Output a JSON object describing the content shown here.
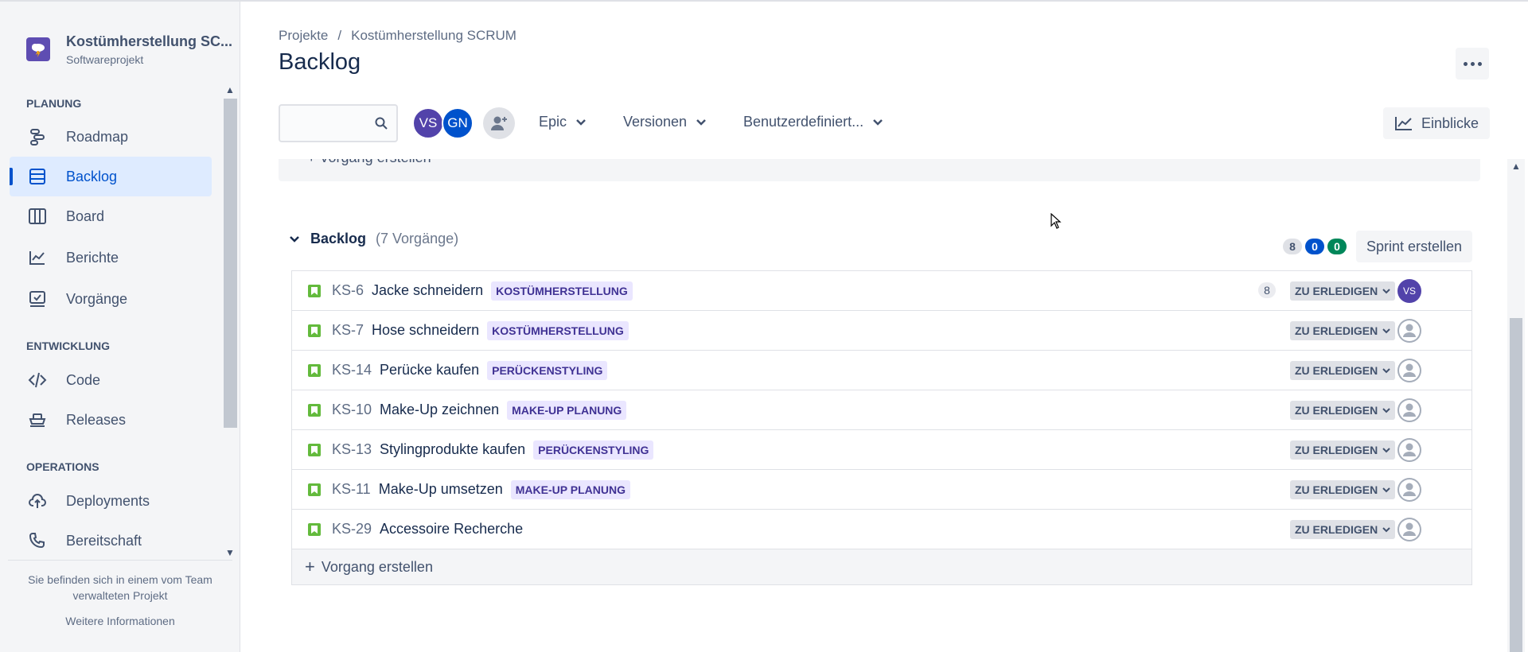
{
  "project": {
    "name": "Kostümherstellung SC...",
    "type": "Softwareprojekt"
  },
  "sidebar": {
    "sections": [
      {
        "title": "PLANUNG"
      },
      {
        "title": "ENTWICKLUNG"
      },
      {
        "title": "OPERATIONS"
      }
    ],
    "items": [
      {
        "label": "Roadmap",
        "icon": "roadmap-icon"
      },
      {
        "label": "Backlog",
        "icon": "backlog-icon",
        "active": true
      },
      {
        "label": "Board",
        "icon": "board-icon"
      },
      {
        "label": "Berichte",
        "icon": "reports-icon"
      },
      {
        "label": "Vorgänge",
        "icon": "issues-icon"
      },
      {
        "label": "Code",
        "icon": "code-icon"
      },
      {
        "label": "Releases",
        "icon": "releases-icon"
      },
      {
        "label": "Deployments",
        "icon": "deployments-icon"
      },
      {
        "label": "Bereitschaft",
        "icon": "on-call-icon"
      }
    ],
    "footer": {
      "text": "Sie befinden sich in einem vom Team verwalteten Projekt",
      "link": "Weitere Informationen"
    }
  },
  "header": {
    "breadcrumb": [
      "Projekte",
      "/",
      "Kostümherstellung SCRUM"
    ],
    "title": "Backlog"
  },
  "toolbar": {
    "search_value": "",
    "avatars": [
      {
        "initials": "VS",
        "color": "#5243aa"
      },
      {
        "initials": "GN",
        "color": "#0052cc"
      }
    ],
    "filters": [
      "Epic",
      "Versionen",
      "Benutzerdefiniert..."
    ],
    "insights_label": "Einblicke"
  },
  "sprint_remnant": {
    "create_label": "Vorgang erstellen"
  },
  "backlog": {
    "title": "Backlog",
    "count_label": "(7 Vorgänge)",
    "badges": [
      {
        "value": "8",
        "bg": "#dfe1e6",
        "fg": "#42526e"
      },
      {
        "value": "0",
        "bg": "#0052cc",
        "fg": "#ffffff"
      },
      {
        "value": "0",
        "bg": "#00875a",
        "fg": "#ffffff"
      }
    ],
    "sprint_button": "Sprint erstellen",
    "status_label": "ZU ERLEDIGEN",
    "issues": [
      {
        "key": "KS-6",
        "summary": "Jacke schneidern",
        "epic": "KOSTÜMHERSTELLUNG",
        "estimate": "8",
        "assignee": "VS"
      },
      {
        "key": "KS-7",
        "summary": "Hose schneidern",
        "epic": "KOSTÜMHERSTELLUNG",
        "estimate": "",
        "assignee": ""
      },
      {
        "key": "KS-14",
        "summary": "Perücke kaufen",
        "epic": "PERÜCKENSTYLING",
        "estimate": "",
        "assignee": ""
      },
      {
        "key": "KS-10",
        "summary": "Make-Up zeichnen",
        "epic": "MAKE-UP PLANUNG",
        "estimate": "",
        "assignee": ""
      },
      {
        "key": "KS-13",
        "summary": "Stylingprodukte kaufen",
        "epic": "PERÜCKENSTYLING",
        "estimate": "",
        "assignee": ""
      },
      {
        "key": "KS-11",
        "summary": "Make-Up umsetzen",
        "epic": "MAKE-UP PLANUNG",
        "estimate": "",
        "assignee": ""
      },
      {
        "key": "KS-29",
        "summary": "Accessoire Recherche",
        "epic": "",
        "estimate": "",
        "assignee": ""
      }
    ],
    "create_issue_label": "Vorgang erstellen"
  },
  "colors": {
    "accent": "#0052cc",
    "story": "#63ba3c",
    "epic_bg": "#eae6ff",
    "epic_fg": "#403294"
  }
}
